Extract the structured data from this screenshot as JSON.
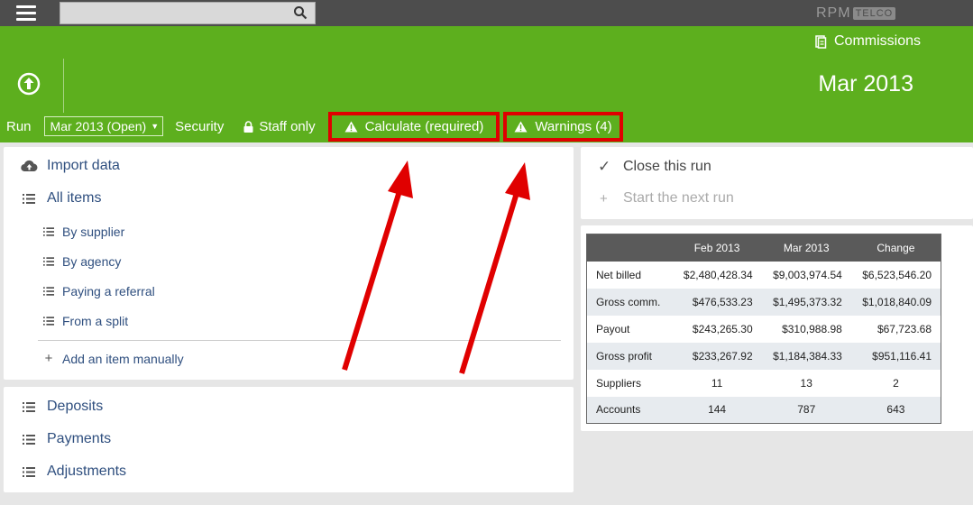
{
  "topbar": {
    "search_placeholder": "",
    "brand_main": "RPM",
    "brand_sub": "TELCO"
  },
  "header": {
    "module": "Commissions",
    "period_title": "Mar 2013",
    "run_label": "Run",
    "run_select_value": "Mar 2013 (Open)",
    "security": "Security",
    "staff_only": "Staff only",
    "calculate": "Calculate (required)",
    "warnings": "Warnings (4)"
  },
  "left": {
    "import": "Import data",
    "all_items": "All items",
    "sub_items": [
      "By supplier",
      "By agency",
      "Paying a referral",
      "From a split"
    ],
    "add_item": "Add an item manually"
  },
  "left2": {
    "items": [
      "Deposits",
      "Payments",
      "Adjustments"
    ]
  },
  "right": {
    "close_run": "Close this run",
    "next_run": "Start the next run"
  },
  "summary_table": {
    "headers": [
      "",
      "Feb 2013",
      "Mar 2013",
      "Change"
    ],
    "rows": [
      [
        "Net billed",
        "$2,480,428.34",
        "$9,003,974.54",
        "$6,523,546.20"
      ],
      [
        "Gross comm.",
        "$476,533.23",
        "$1,495,373.32",
        "$1,018,840.09"
      ],
      [
        "Payout",
        "$243,265.30",
        "$310,988.98",
        "$67,723.68"
      ],
      [
        "Gross profit",
        "$233,267.92",
        "$1,184,384.33",
        "$951,116.41"
      ],
      [
        "Suppliers",
        "11",
        "13",
        "2"
      ],
      [
        "Accounts",
        "144",
        "787",
        "643"
      ]
    ]
  },
  "colors": {
    "green": "#5daf1e",
    "topbar": "#4d4d4d",
    "highlight": "#e00000",
    "link": "#2f4f7f"
  },
  "icons": [
    "menu-icon",
    "search-icon",
    "commissions-icon",
    "upload-icon",
    "lock-icon",
    "warning-icon",
    "cloud-upload-icon",
    "list-icon",
    "plus-icon",
    "check-icon"
  ]
}
